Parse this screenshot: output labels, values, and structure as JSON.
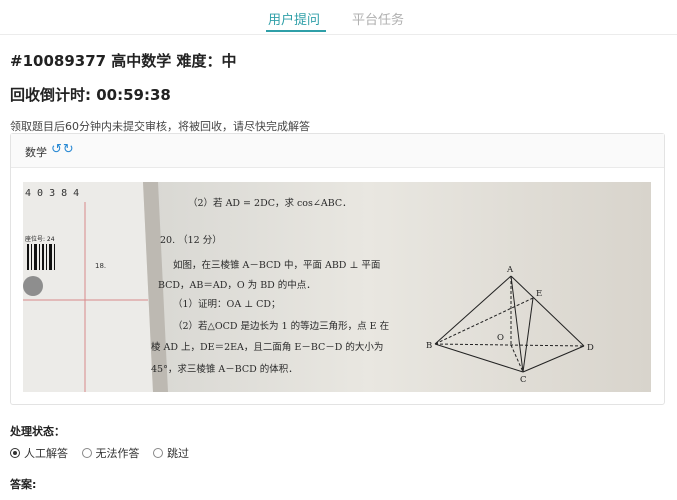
{
  "tabs": [
    {
      "label": "用户提问",
      "active": true
    },
    {
      "label": "平台任务",
      "active": false
    }
  ],
  "task": {
    "title": "#10089377 高中数学 难度：中",
    "countdown": "回收倒计时: 00:59:38",
    "notice": "领取题目后60分钟内未提交审核，将被回收，请尽快完成解答"
  },
  "question_panel": {
    "subject": "数学",
    "icons": [
      "rotate-left-icon",
      "rotate-right-icon"
    ],
    "photo": {
      "page_numbers": "4 0 3 8 4",
      "seat_label": "座位号: 24",
      "row_number": "18.",
      "prev_question": "（2）若 AD = 2DC，求 cos∠ABC．",
      "q_number": "20. （12 分）",
      "line1": "如图，在三棱锥 A－BCD 中，平面 ABD ⊥ 平面",
      "line2": "BCD，AB＝AD，O 为 BD 的中点．",
      "line3": "（1）证明：OA ⊥ CD；",
      "line4": "（2）若△OCD 是边长为 1 的等边三角形，点 E 在",
      "line5": "棱 AD 上，DE＝2EA，且二面角 E－BC－D 的大小为",
      "line6": "45°，求三棱锥 A－BCD 的体积．",
      "fig_labels": {
        "A": "A",
        "B": "B",
        "C": "C",
        "D": "D",
        "E": "E",
        "O": "O"
      }
    }
  },
  "processing": {
    "label": "处理状态：",
    "options": [
      {
        "label": "人工解答",
        "checked": true
      },
      {
        "label": "无法作答",
        "checked": false
      },
      {
        "label": "跳过",
        "checked": false
      }
    ]
  },
  "answer": {
    "label": "答案:"
  },
  "colors": {
    "accent": "#2f9fa8",
    "icon_blue": "#2a8ad4"
  }
}
